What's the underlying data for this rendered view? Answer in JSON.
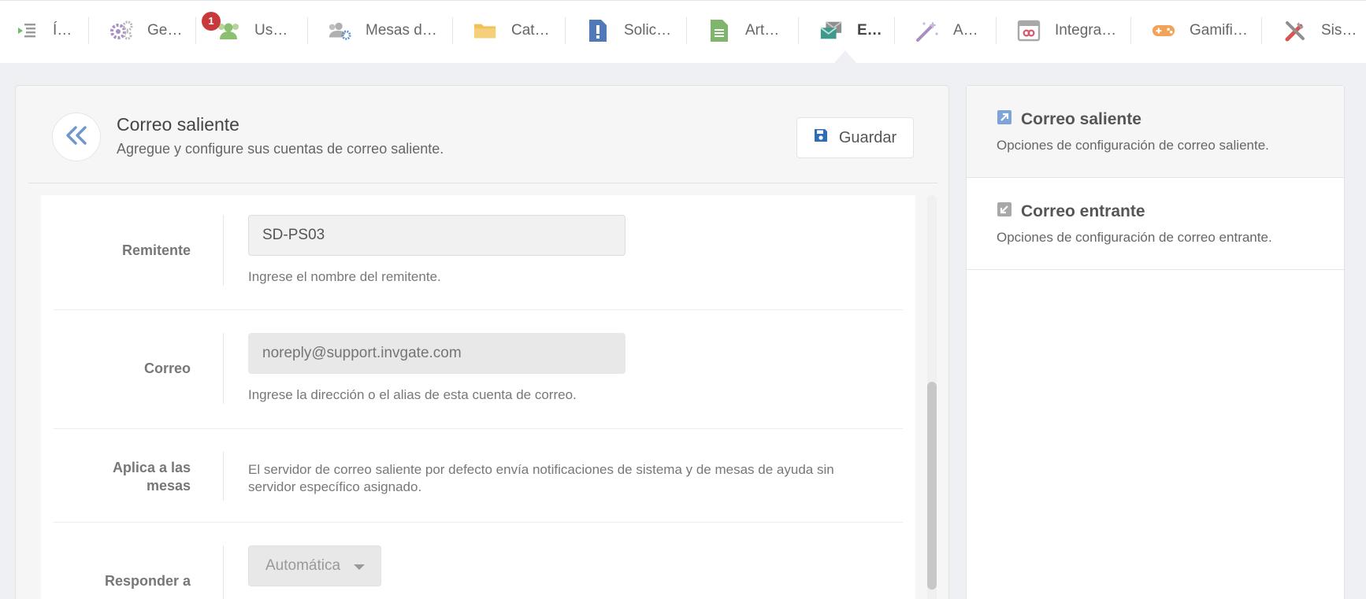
{
  "nav": {
    "items": [
      {
        "label": "Í…",
        "icon": "index-icon"
      },
      {
        "label": "Ge…",
        "icon": "gears-icon"
      },
      {
        "label": "Us…",
        "icon": "users-icon",
        "badge": "1"
      },
      {
        "label": "Mesas d…",
        "icon": "users-gear-icon"
      },
      {
        "label": "Cat…",
        "icon": "folder-icon"
      },
      {
        "label": "Solic…",
        "icon": "request-icon"
      },
      {
        "label": "Art…",
        "icon": "article-icon"
      },
      {
        "label": "E…",
        "icon": "email-icon",
        "active": true
      },
      {
        "label": "A…",
        "icon": "magic-wand-icon"
      },
      {
        "label": "Integra…",
        "icon": "integration-icon"
      },
      {
        "label": "Gamifi…",
        "icon": "gamepad-icon"
      },
      {
        "label": "Sis…",
        "icon": "tools-icon"
      }
    ]
  },
  "header": {
    "title": "Correo saliente",
    "subtitle": "Agregue y configure sus cuentas de correo saliente.",
    "save_label": "Guardar"
  },
  "form": {
    "remitente": {
      "label": "Remitente",
      "value": "SD-PS03",
      "help": "Ingrese el nombre del remitente."
    },
    "correo": {
      "label": "Correo",
      "placeholder": "noreply@support.invgate.com",
      "help": "Ingrese la dirección o el alias de esta cuenta de correo."
    },
    "aplica": {
      "label_line1": "Aplica a las",
      "label_line2": "mesas",
      "desc_line1": "El servidor de correo saliente por defecto envía notificaciones de sistema y de mesas de ayuda sin",
      "desc_line2": "servidor específico asignado."
    },
    "responder": {
      "label": "Responder a",
      "selected": "Automática"
    }
  },
  "sidebar": {
    "items": [
      {
        "title": "Correo saliente",
        "desc": "Opciones de configuración de correo saliente.",
        "active": true
      },
      {
        "title": "Correo entrante",
        "desc": "Opciones de configuración de correo entrante.",
        "active": false
      }
    ]
  },
  "colors": {
    "accent": "#2f6db5",
    "badge": "#c9393b",
    "background": "#eef0f4"
  }
}
